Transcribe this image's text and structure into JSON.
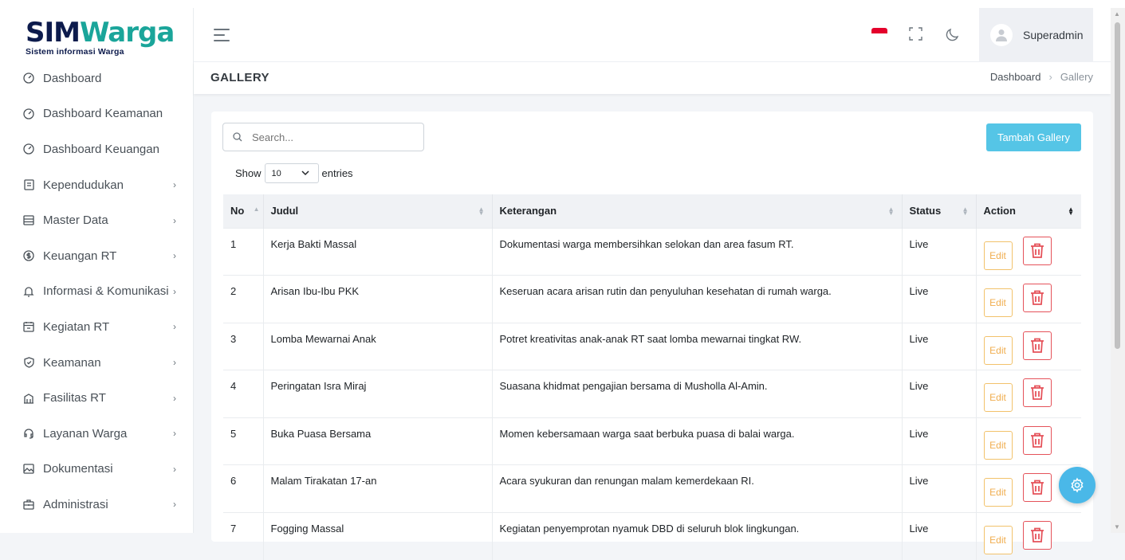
{
  "brand": {
    "name_part1": "SIM",
    "name_part2": "Warga",
    "tagline": "Sistem informasi Warga"
  },
  "sidebar": {
    "items": [
      {
        "label": "Dashboard",
        "icon": "dashboard-icon",
        "has_submenu": false
      },
      {
        "label": "Dashboard Keamanan",
        "icon": "dashboard-icon",
        "has_submenu": false
      },
      {
        "label": "Dashboard Keuangan",
        "icon": "dashboard-icon",
        "has_submenu": false
      },
      {
        "label": "Kependudukan",
        "icon": "id-card-icon",
        "has_submenu": true
      },
      {
        "label": "Master Data",
        "icon": "database-icon",
        "has_submenu": true
      },
      {
        "label": "Keuangan RT",
        "icon": "dollar-circle-icon",
        "has_submenu": true
      },
      {
        "label": "Informasi & Komunikasi",
        "icon": "bell-icon",
        "has_submenu": true
      },
      {
        "label": "Kegiatan RT",
        "icon": "calendar-icon",
        "has_submenu": true
      },
      {
        "label": "Keamanan",
        "icon": "shield-icon",
        "has_submenu": true
      },
      {
        "label": "Fasilitas RT",
        "icon": "building-icon",
        "has_submenu": true
      },
      {
        "label": "Layanan Warga",
        "icon": "headset-icon",
        "has_submenu": true
      },
      {
        "label": "Dokumentasi",
        "icon": "image-icon",
        "has_submenu": true
      },
      {
        "label": "Administrasi",
        "icon": "briefcase-icon",
        "has_submenu": true
      }
    ],
    "chevron": "›"
  },
  "header": {
    "user_name": "Superadmin",
    "flag_colors": [
      "#e4002b",
      "#ffffff"
    ]
  },
  "page": {
    "title": "GALLERY",
    "breadcrumb": [
      "Dashboard",
      "Gallery"
    ],
    "breadcrumb_sep": "›"
  },
  "toolbar": {
    "search_placeholder": "Search...",
    "add_button": "Tambah Gallery",
    "show_label": "Show",
    "entries_value": "10",
    "entries_label": "entries"
  },
  "table": {
    "columns": [
      "No",
      "Judul",
      "Keterangan",
      "Status",
      "Action"
    ],
    "rows": [
      {
        "no": "1",
        "judul": "Kerja Bakti Massal",
        "keterangan": "Dokumentasi warga membersihkan selokan dan area fasum RT.",
        "status": "Live"
      },
      {
        "no": "2",
        "judul": "Arisan Ibu-Ibu PKK",
        "keterangan": "Keseruan acara arisan rutin dan penyuluhan kesehatan di rumah warga.",
        "status": "Live"
      },
      {
        "no": "3",
        "judul": "Lomba Mewarnai Anak",
        "keterangan": "Potret kreativitas anak-anak RT saat lomba mewarnai tingkat RW.",
        "status": "Live"
      },
      {
        "no": "4",
        "judul": "Peringatan Isra Miraj",
        "keterangan": "Suasana khidmat pengajian bersama di Musholla Al-Amin.",
        "status": "Live"
      },
      {
        "no": "5",
        "judul": "Buka Puasa Bersama",
        "keterangan": "Momen kebersamaan warga saat berbuka puasa di balai warga.",
        "status": "Live"
      },
      {
        "no": "6",
        "judul": "Malam Tirakatan 17-an",
        "keterangan": "Acara syukuran dan renungan malam kemerdekaan RI.",
        "status": "Live"
      },
      {
        "no": "7",
        "judul": "Fogging Massal",
        "keterangan": "Kegiatan penyemprotan nyamuk DBD di seluruh blok lingkungan.",
        "status": "Live"
      }
    ],
    "edit_label": "Edit"
  },
  "colors": {
    "accent": "#55c5e6",
    "brand_dark": "#0d1b4c",
    "brand_teal": "#1aa59a",
    "edit": "#f0ad4e",
    "delete": "#e5525a"
  }
}
